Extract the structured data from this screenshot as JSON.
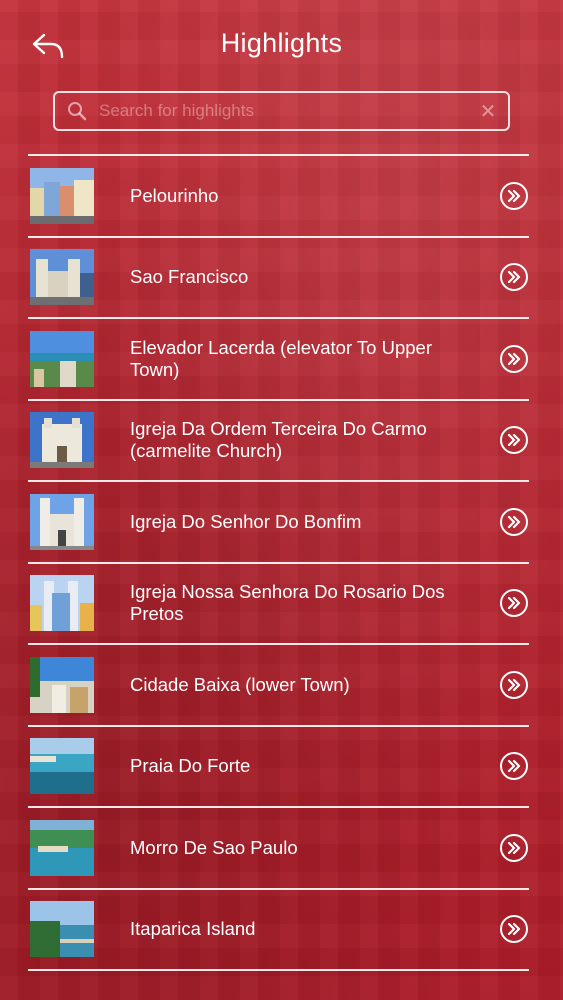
{
  "header": {
    "title": "Highlights"
  },
  "search": {
    "placeholder": "Search for highlights",
    "value": ""
  },
  "items": [
    {
      "label": "Pelourinho"
    },
    {
      "label": "Sao Francisco"
    },
    {
      "label": "Elevador Lacerda (elevator To Upper Town)"
    },
    {
      "label": "Igreja Da Ordem Terceira Do Carmo (carmelite Church)"
    },
    {
      "label": "Igreja Do Senhor Do Bonfim"
    },
    {
      "label": "Igreja Nossa Senhora Do Rosario Dos Pretos"
    },
    {
      "label": "Cidade Baixa (lower Town)"
    },
    {
      "label": "Praia Do Forte"
    },
    {
      "label": "Morro De Sao Paulo"
    },
    {
      "label": "Itaparica Island"
    }
  ],
  "colors": {
    "background": "#b82631",
    "text": "#ffffff"
  },
  "icons": {
    "back": "back-arrow-icon",
    "search": "search-icon",
    "clear": "clear-icon",
    "row_action": "double-chevron-right-icon"
  }
}
